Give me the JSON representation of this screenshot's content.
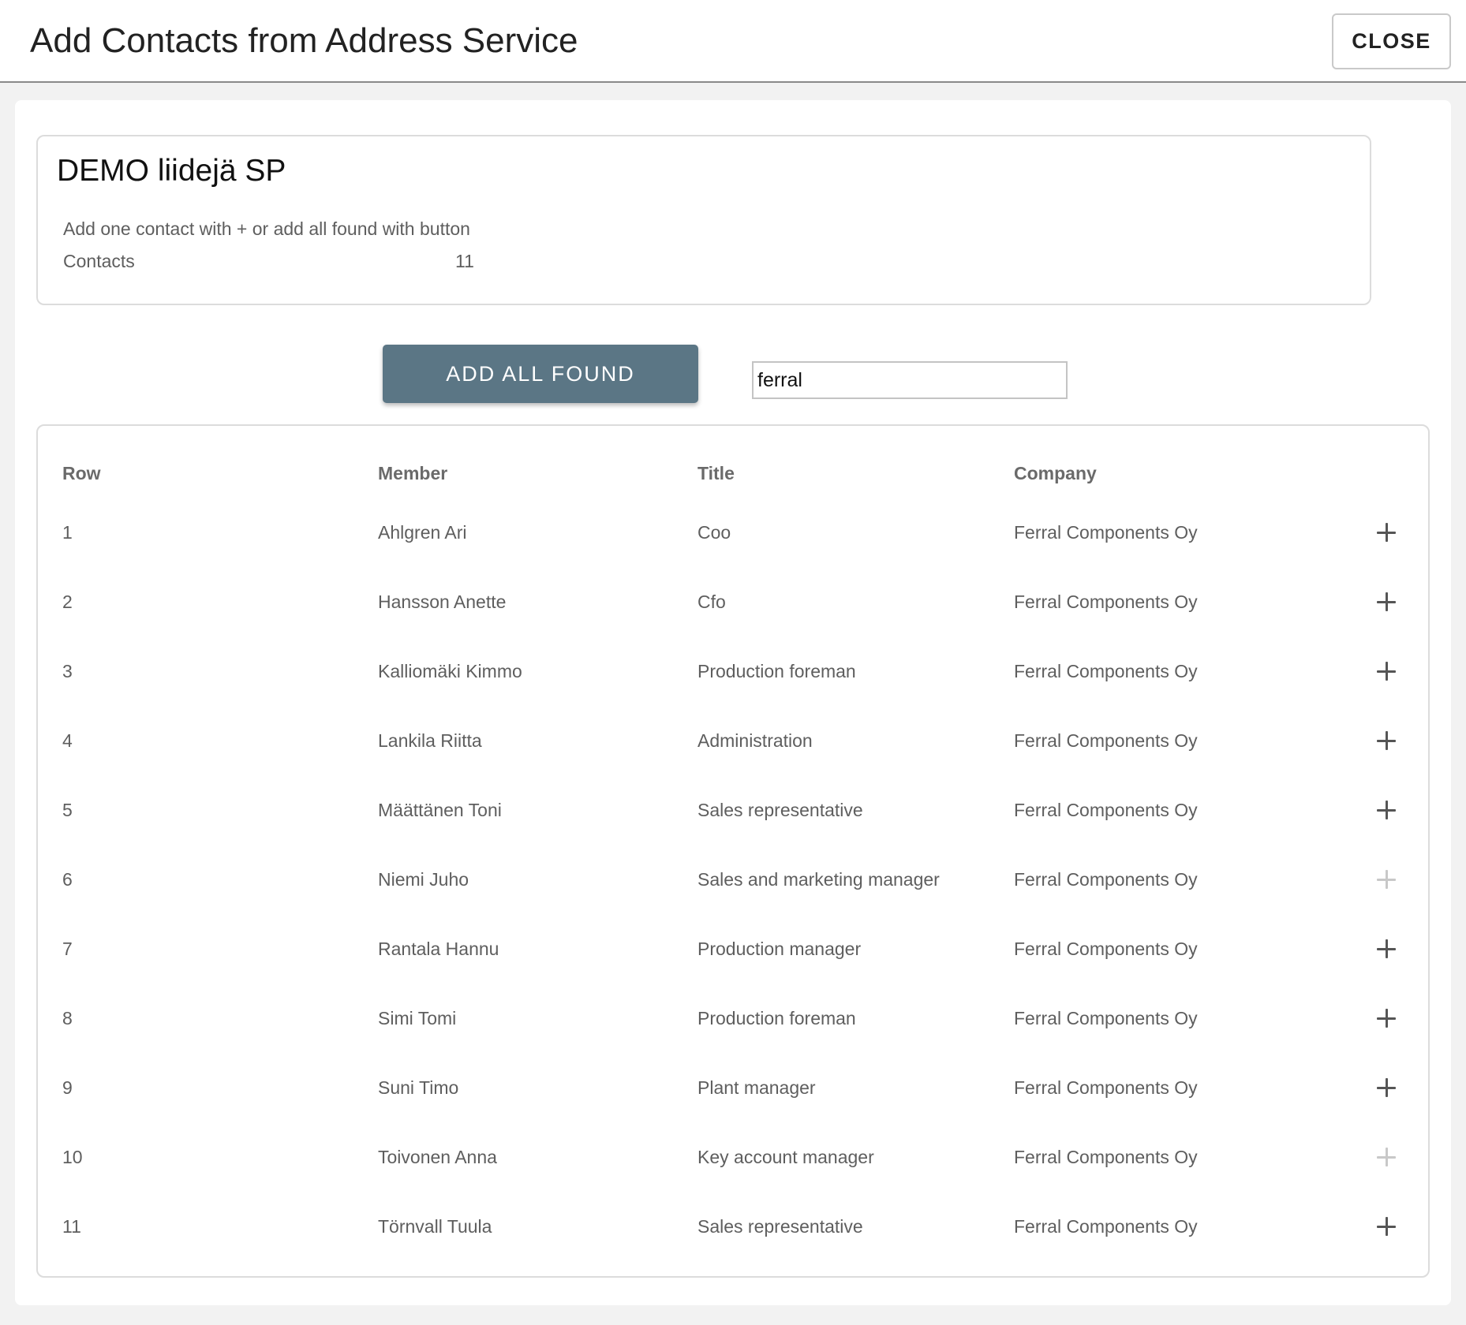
{
  "header": {
    "title": "Add Contacts from Address Service",
    "close_label": "CLOSE"
  },
  "list_info": {
    "name": "DEMO liidejä SP",
    "hint": "Add one contact with + or add all found with button",
    "contacts_label": "Contacts",
    "contacts_count": "11"
  },
  "actions": {
    "add_all_label": "ADD ALL FOUND",
    "search_value": "ferral"
  },
  "table": {
    "columns": {
      "row": "Row",
      "member": "Member",
      "title": "Title",
      "company": "Company"
    },
    "rows": [
      {
        "row": "1",
        "member": "Ahlgren Ari",
        "title": "Coo",
        "company": "Ferral Components Oy",
        "dim": false
      },
      {
        "row": "2",
        "member": "Hansson Anette",
        "title": "Cfo",
        "company": "Ferral Components Oy",
        "dim": false
      },
      {
        "row": "3",
        "member": "Kalliomäki Kimmo",
        "title": "Production foreman",
        "company": "Ferral Components Oy",
        "dim": false
      },
      {
        "row": "4",
        "member": "Lankila Riitta",
        "title": "Administration",
        "company": "Ferral Components Oy",
        "dim": false
      },
      {
        "row": "5",
        "member": "Määttänen Toni",
        "title": "Sales representative",
        "company": "Ferral Components Oy",
        "dim": false
      },
      {
        "row": "6",
        "member": "Niemi Juho",
        "title": "Sales and marketing manager",
        "company": "Ferral Components Oy",
        "dim": true
      },
      {
        "row": "7",
        "member": "Rantala Hannu",
        "title": "Production manager",
        "company": "Ferral Components Oy",
        "dim": false
      },
      {
        "row": "8",
        "member": "Simi Tomi",
        "title": "Production foreman",
        "company": "Ferral Components Oy",
        "dim": false
      },
      {
        "row": "9",
        "member": "Suni Timo",
        "title": "Plant manager",
        "company": "Ferral Components Oy",
        "dim": false
      },
      {
        "row": "10",
        "member": "Toivonen Anna",
        "title": "Key account manager",
        "company": "Ferral Components Oy",
        "dim": true
      },
      {
        "row": "11",
        "member": "Törnvall Tuula",
        "title": "Sales representative",
        "company": "Ferral Components Oy",
        "dim": false
      }
    ]
  }
}
